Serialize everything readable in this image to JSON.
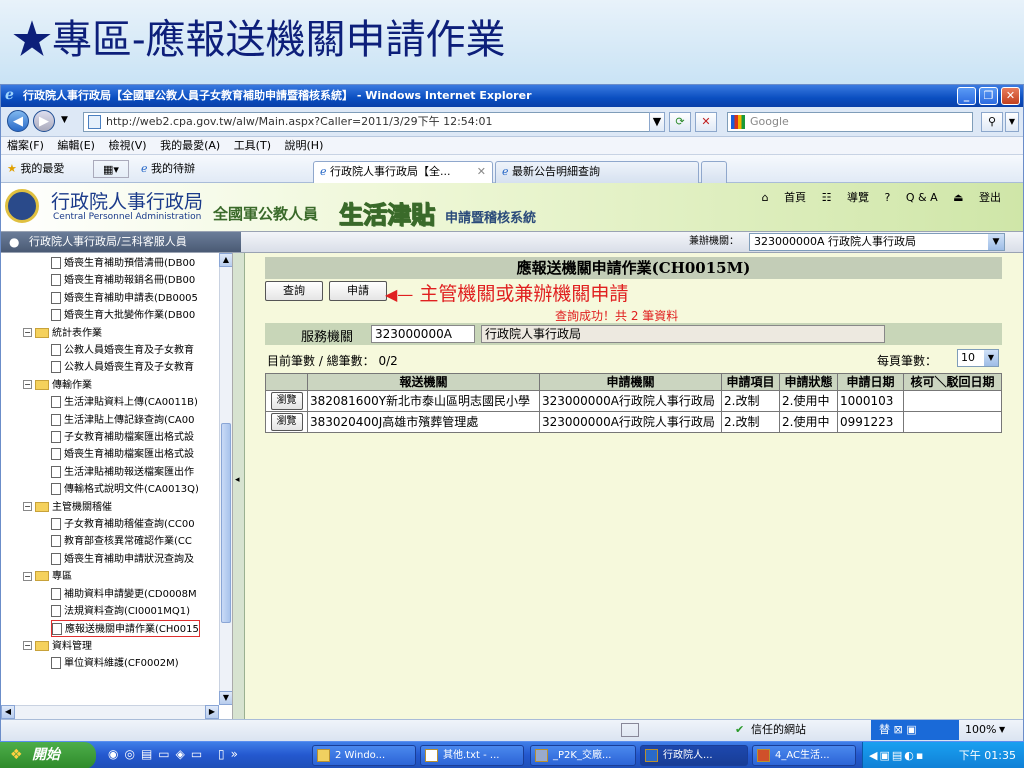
{
  "slide_title": "★專區-應報送機關申請作業",
  "window": {
    "title": "行政院人事行政局【全國軍公教人員子女教育補助申請暨稽核系統】 - Windows Internet Explorer",
    "url": "http://web2.cpa.gov.tw/alw/Main.aspx?Caller=2011/3/29下午 12:54:01",
    "search_placeholder": "Google"
  },
  "menu": [
    "檔案(F)",
    "編輯(E)",
    "檢視(V)",
    "我的最愛(A)",
    "工具(T)",
    "說明(H)"
  ],
  "favorites": {
    "favorites_label": "我的最愛",
    "waiting_label": "我的待辦",
    "tabs": [
      "行政院人事行政局【全...",
      "最新公告明細查詢"
    ]
  },
  "banner": {
    "org_name": "行政院人事行政局",
    "org_en": "Central Personnel Administration",
    "sys_prefix": "全國軍公教人員",
    "sys_name": "生活津貼",
    "sys_suffix": "申請暨稽核系統",
    "links": [
      "首頁",
      "導覽",
      "Q & A",
      "登出"
    ]
  },
  "userbar": {
    "user": "行政院人事行政局/三科客服人員",
    "agency_label": "兼辦機關：",
    "agency_value": "323000000A 行政院人事行政局"
  },
  "tree": [
    {
      "label": "婚喪生育補助預借清冊(DB00",
      "kind": "doc",
      "indent": 1
    },
    {
      "label": "婚喪生育補助報銷名冊(DB00",
      "kind": "doc",
      "indent": 1
    },
    {
      "label": "婚喪生育補助申請表(DB0005",
      "kind": "doc",
      "indent": 1
    },
    {
      "label": "婚喪生育大批變佈作業(DB00",
      "kind": "doc",
      "indent": 1
    },
    {
      "label": "統計表作業",
      "kind": "folder",
      "indent": 0
    },
    {
      "label": "公教人員婚喪生育及子女教育",
      "kind": "doc",
      "indent": 1
    },
    {
      "label": "公教人員婚喪生育及子女教育",
      "kind": "doc",
      "indent": 1
    },
    {
      "label": "傳輸作業",
      "kind": "folder",
      "indent": 0
    },
    {
      "label": "生活津貼資料上傳(CA0011B)",
      "kind": "doc",
      "indent": 1
    },
    {
      "label": "生活津貼上傳記錄查詢(CA00",
      "kind": "doc",
      "indent": 1
    },
    {
      "label": "子女教育補助檔案匯出格式設",
      "kind": "doc",
      "indent": 1
    },
    {
      "label": "婚喪生育補助檔案匯出格式設",
      "kind": "doc",
      "indent": 1
    },
    {
      "label": "生活津貼補助報送檔案匯出作",
      "kind": "doc",
      "indent": 1
    },
    {
      "label": "傳輸格式說明文件(CA0013Q)",
      "kind": "doc",
      "indent": 1
    },
    {
      "label": "主管機關稽催",
      "kind": "folder",
      "indent": 0
    },
    {
      "label": "子女教育補助稽催查詢(CC00",
      "kind": "doc",
      "indent": 1
    },
    {
      "label": "教育部查核異常確認作業(CC",
      "kind": "doc",
      "indent": 1
    },
    {
      "label": "婚喪生育補助申請狀況查詢及",
      "kind": "doc",
      "indent": 1
    },
    {
      "label": "專區",
      "kind": "folder",
      "indent": 0
    },
    {
      "label": "補助資料申請變更(CD0008M",
      "kind": "doc",
      "indent": 1
    },
    {
      "label": "法規資料查詢(CI0001MQ1)",
      "kind": "doc",
      "indent": 1
    },
    {
      "label": "應報送機關申請作業(CH0015",
      "kind": "doc",
      "indent": 1,
      "selected": true
    },
    {
      "label": "資料管理",
      "kind": "folder",
      "indent": 0
    },
    {
      "label": "單位資料維護(CF0002M)",
      "kind": "doc",
      "indent": 1
    }
  ],
  "main": {
    "page_title": "應報送機關申請作業(CH0015M)",
    "query_button": "查詢",
    "apply_button": "申請",
    "arrow_note": "主管機關或兼辦機關申請",
    "query_msg": "查詢成功！共 2 筆資料",
    "service_label": "服務機關",
    "service_code": "323000000A",
    "service_name": "行政院人事行政局",
    "count_label": "目前筆數 / 總筆數： 0/2",
    "pagesize_label": "每頁筆數：",
    "pagesize_value": "10",
    "headers": [
      "",
      "報送機關",
      "申請機關",
      "申請項目",
      "申請狀態",
      "申請日期",
      "核可＼駁回日期"
    ],
    "rows": [
      {
        "btn": "瀏覽",
        "report": "382081600Y新北市泰山區明志國民小學",
        "apply": "323000000A行政院人事行政局",
        "item": "2.改制",
        "status": "2.使用中",
        "date": "1000103",
        "approve": ""
      },
      {
        "btn": "瀏覽",
        "report": "383020400J高雄市殯葬管理處",
        "apply": "323000000A行政院人事行政局",
        "item": "2.改制",
        "status": "2.使用中",
        "date": "0991223",
        "approve": ""
      }
    ]
  },
  "status": {
    "trusted": "信任的網站",
    "zoom": "100%"
  },
  "taskbar": {
    "start": "開始",
    "tasks": [
      "2 Windo...",
      "其他.txt - ...",
      "_P2K_交廠...",
      "行政院人...",
      "4_AC生活..."
    ],
    "clock": "下午 01:35"
  }
}
